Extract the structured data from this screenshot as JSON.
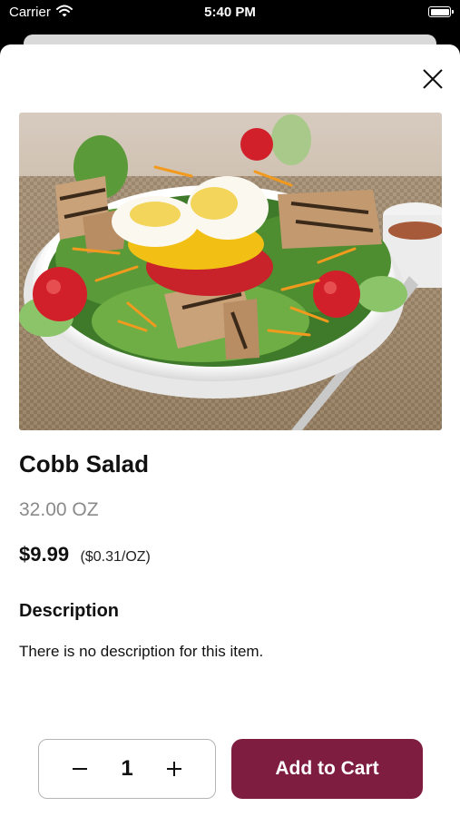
{
  "status_bar": {
    "carrier": "Carrier",
    "time": "5:40 PM"
  },
  "product": {
    "name": "Cobb Salad",
    "size": "32.00 OZ",
    "price": "$9.99",
    "unit_price": "($0.31/OZ)",
    "image": "cobb-salad-photo"
  },
  "description": {
    "heading": "Description",
    "text": "There is no description for this item."
  },
  "cart": {
    "quantity": "1",
    "add_label": "Add to Cart",
    "accent_color": "#7e1d3f"
  },
  "icons": [
    "wifi-icon",
    "battery-icon",
    "close-icon",
    "minus-icon",
    "plus-icon"
  ]
}
